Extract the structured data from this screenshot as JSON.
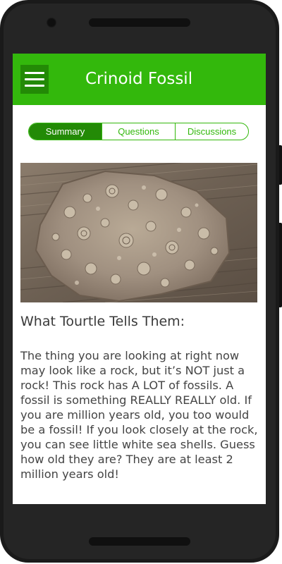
{
  "app_bar": {
    "title": "Crinoid Fossil",
    "menu_icon": "hamburger-menu-icon",
    "color": "#33b80c",
    "menu_bg": "#238a06"
  },
  "tabs": [
    {
      "label": "Summary",
      "active": true
    },
    {
      "label": "Questions",
      "active": false
    },
    {
      "label": "Discussions",
      "active": false
    }
  ],
  "image": {
    "subject": "crinoid-fossil-rock"
  },
  "content": {
    "heading": "What Tourtle Tells Them:",
    "body": "The thing you are looking at right now may look like a rock, but it’s NOT just a rock! This rock has  A LOT of fossils. A fossil is something REALLY REALLY old. If you are million years old, you too would be a fossil! If you look closely at the rock, you can see little white sea shells. Guess how old they are? They are at least 2 million years old!"
  }
}
